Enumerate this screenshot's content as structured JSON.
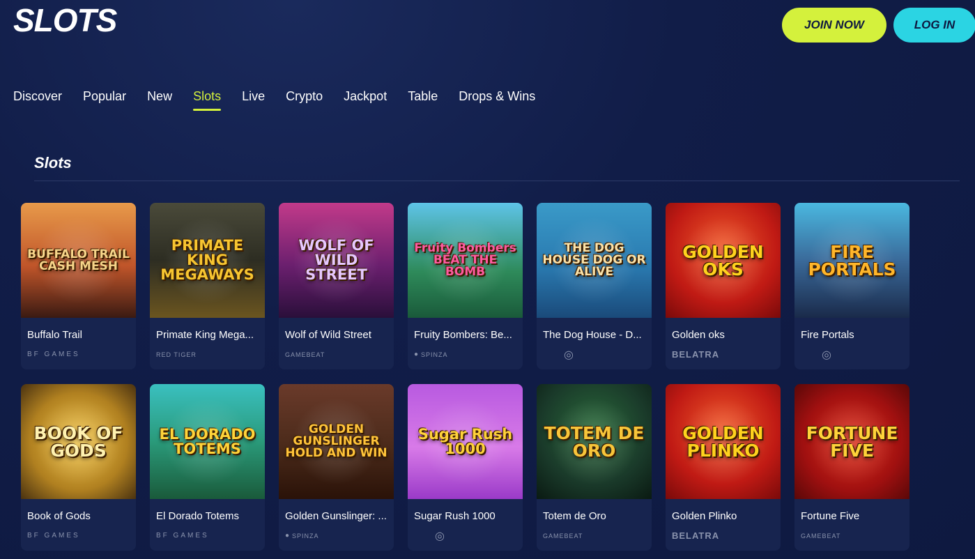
{
  "header": {
    "logo": "SLOTS",
    "join_label": "JOIN NOW",
    "login_label": "LOG IN"
  },
  "nav": [
    {
      "label": "Discover",
      "active": false
    },
    {
      "label": "Popular",
      "active": false
    },
    {
      "label": "New",
      "active": false
    },
    {
      "label": "Slots",
      "active": true
    },
    {
      "label": "Live",
      "active": false
    },
    {
      "label": "Crypto",
      "active": false
    },
    {
      "label": "Jackpot",
      "active": false
    },
    {
      "label": "Table",
      "active": false
    },
    {
      "label": "Drops & Wins",
      "active": false
    }
  ],
  "section": {
    "title": "Slots"
  },
  "colors": {
    "accent": "#d4f13c",
    "login": "#2bd4e3",
    "background": "#0f1a3f",
    "card": "#17244f"
  },
  "games": [
    {
      "title": "Buffalo Trail",
      "provider": "BF GAMES",
      "art": "BUFFALO TRAIL CASH MESH",
      "bg": "linear-gradient(180deg,#e89a4a 0%,#c0552a 55%,#3a1a12 100%)",
      "fg": "#f7d58a"
    },
    {
      "title": "Primate King Mega...",
      "provider": "RED TIGER",
      "art": "PRIMATE KING MEGAWAYS",
      "bg": "linear-gradient(180deg,#4a4a3a 0%,#2d2d22 50%,#6b5520 100%)",
      "fg": "#f7c531"
    },
    {
      "title": "Wolf of Wild Street",
      "provider": "GAMEBEAT",
      "art": "WOLF OF WILD STREET",
      "bg": "linear-gradient(180deg,#c23a8a 0%,#6a1f6e 55%,#2a0f3a 100%)",
      "fg": "#e6c8ff"
    },
    {
      "title": "Fruity Bombers: Be...",
      "provider": "SPINZA",
      "art": "Fruity Bombers BEAT THE BOMB",
      "bg": "linear-gradient(180deg,#5ec4e8 0%,#2e8a5a 60%,#1a5a3a 100%)",
      "fg": "#ff5aa0"
    },
    {
      "title": "The Dog House - D...",
      "provider": "",
      "art": "THE DOG HOUSE DOG OR ALIVE",
      "bg": "linear-gradient(180deg,#3a9ac8 0%,#2a7ab0 55%,#1a4a7a 100%)",
      "fg": "#fbe2a8"
    },
    {
      "title": "Golden oks",
      "provider": "BELATRA",
      "art": "GOLDEN OKS",
      "bg": "radial-gradient(circle at 50% 40%,#f05a2a 0%,#c01a14 60%,#7a0a0a 100%)",
      "fg": "#ffd21e"
    },
    {
      "title": "Fire Portals",
      "provider": "",
      "art": "FIRE PORTALS",
      "bg": "linear-gradient(180deg,#4ab8e0 0%,#3a6a9a 50%,#1a2a4a 100%)",
      "fg": "#ffb62a"
    },
    {
      "title": "Book of Gods",
      "provider": "BF GAMES",
      "art": "BOOK OF GODS",
      "bg": "radial-gradient(circle at 50% 50%,#f5c84a 0%,#b08020 60%,#4a3210 100%)",
      "fg": "#fff2b0"
    },
    {
      "title": "El Dorado Totems",
      "provider": "BF GAMES",
      "art": "EL DORADO TOTEMS",
      "bg": "linear-gradient(180deg,#3ac0c0 0%,#2a9a7a 50%,#1a5a3a 100%)",
      "fg": "#ffd43a"
    },
    {
      "title": "Golden Gunslinger: ...",
      "provider": "SPINZA",
      "art": "GOLDEN GUNSLINGER HOLD AND WIN",
      "bg": "linear-gradient(180deg,#6a3a2a 0%,#4a2a1a 55%,#2a1208 100%)",
      "fg": "#ffc43a"
    },
    {
      "title": "Sugar Rush 1000",
      "provider": "",
      "art": "Sugar Rush 1000",
      "bg": "linear-gradient(180deg,#b85ae0 0%,#d87ae8 55%,#9a3ac8 100%)",
      "fg": "#ffd23a"
    },
    {
      "title": "Totem de Oro",
      "provider": "GAMEBEAT",
      "art": "TOTEM DE ORO",
      "bg": "radial-gradient(circle at 50% 40%,#2a6a3a 0%,#1a3a2a 60%,#0a1a12 100%)",
      "fg": "#f7c53a"
    },
    {
      "title": "Golden Plinko",
      "provider": "BELATRA",
      "art": "GOLDEN PLINKO",
      "bg": "radial-gradient(circle at 50% 40%,#f05a2a 0%,#c01a14 60%,#7a0a0a 100%)",
      "fg": "#ffd21e"
    },
    {
      "title": "Fortune Five",
      "provider": "GAMEBEAT",
      "art": "FORTUNE FIVE",
      "bg": "radial-gradient(circle at 50% 50%,#e0301a 0%,#a01010 60%,#5a0808 100%)",
      "fg": "#ffd23a"
    }
  ]
}
